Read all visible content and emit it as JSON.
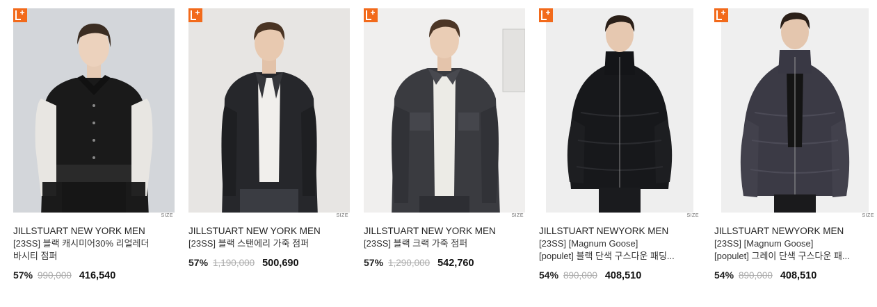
{
  "products": [
    {
      "brand": "JILLSTUART NEW YORK MEN",
      "name_line1": "[23SS] 블랙 캐시미어30% 리얼레더",
      "name_line2": "바시티 점퍼",
      "discount": "57%",
      "original_price": "990,000",
      "sale_price": "416,540",
      "size_label": "SIZE",
      "badge_icon": "lotte-plus-icon"
    },
    {
      "brand": "JILLSTUART NEW YORK MEN",
      "name_line1": "[23SS] 블랙 스탠에리 가죽 점퍼",
      "name_line2": "",
      "discount": "57%",
      "original_price": "1,190,000",
      "sale_price": "500,690",
      "size_label": "SIZE",
      "badge_icon": "lotte-plus-icon"
    },
    {
      "brand": "JILLSTUART NEW YORK MEN",
      "name_line1": "[23SS] 블랙 크랙 가죽 점퍼",
      "name_line2": "",
      "discount": "57%",
      "original_price": "1,290,000",
      "sale_price": "542,760",
      "size_label": "SIZE",
      "badge_icon": "lotte-plus-icon"
    },
    {
      "brand": "JILLSTUART NEWYORK MEN",
      "name_line1": "[23SS] [Magnum Goose]",
      "name_line2": "[populet] 블랙 단색 구스다운 패딩...",
      "discount": "54%",
      "original_price": "890,000",
      "sale_price": "408,510",
      "size_label": "SIZE",
      "badge_icon": "lotte-plus-icon"
    },
    {
      "brand": "JILLSTUART NEWYORK MEN",
      "name_line1": "[23SS] [Magnum Goose]",
      "name_line2": "[populet] 그레이 단색 구스다운 패...",
      "discount": "54%",
      "original_price": "890,000",
      "sale_price": "408,510",
      "size_label": "SIZE",
      "badge_icon": "lotte-plus-icon"
    }
  ],
  "colors": {
    "badge": "#f26a1b",
    "discount_text": "#222222",
    "strike_text": "#aaaaaa"
  }
}
